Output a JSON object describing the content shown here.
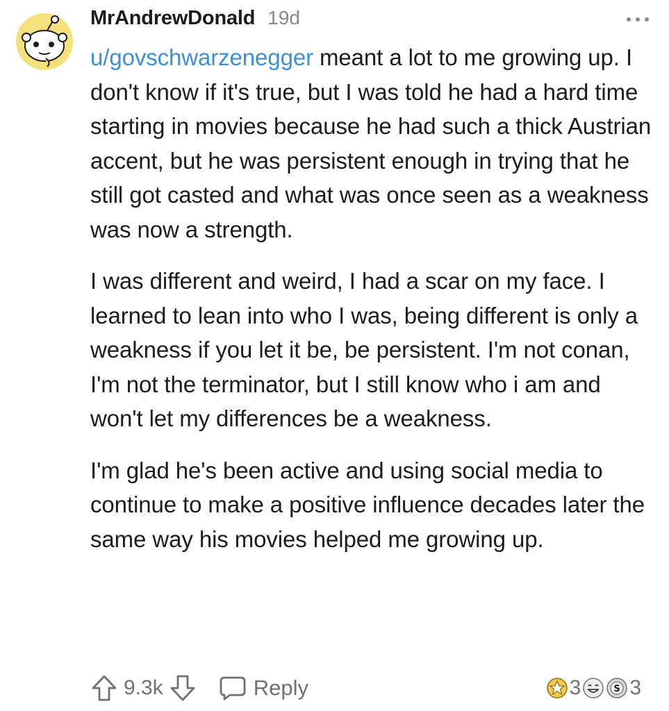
{
  "comment": {
    "avatar_icon": "snoo-avatar-icon",
    "avatar_color": "#f5e17c",
    "username": "MrAndrewDonald",
    "age": "19d",
    "menu_icon": "more-horizontal-icon",
    "mention": "u/govschwarzenegger",
    "paragraphs": [
      " meant a lot to me growing up. I don't know if it's true, but I was told he had a hard time starting in movies because he had such a thick Austrian accent, but he was persistent enough in trying that he still got casted and what was once seen as a weakness was now a strength.",
      "I was different and weird, I had a scar on my face. I learned to lean into who I was, being different is only a weakness if you let it be, be persistent. I'm not conan, I'm not the terminator, but I still know who i am and won't let my differences be a weakness.",
      "I'm glad he's been active and using social media to continue to make a positive influence decades later the same way his movies helped me growing up."
    ],
    "link_color": "#3f8fd8"
  },
  "actions": {
    "upvote_icon": "upvote-arrow-icon",
    "score": "9.3k",
    "downvote_icon": "downvote-arrow-icon",
    "reply_icon": "chat-bubble-icon",
    "reply_label": "Reply"
  },
  "awards": {
    "items": [
      {
        "icon": "helpful-award-icon",
        "count": "3"
      },
      {
        "icon": "laughing-face-award-icon",
        "count": ""
      },
      {
        "icon": "silver-coin-award-icon",
        "count": "3"
      }
    ],
    "award_color": "#f2c94c"
  }
}
